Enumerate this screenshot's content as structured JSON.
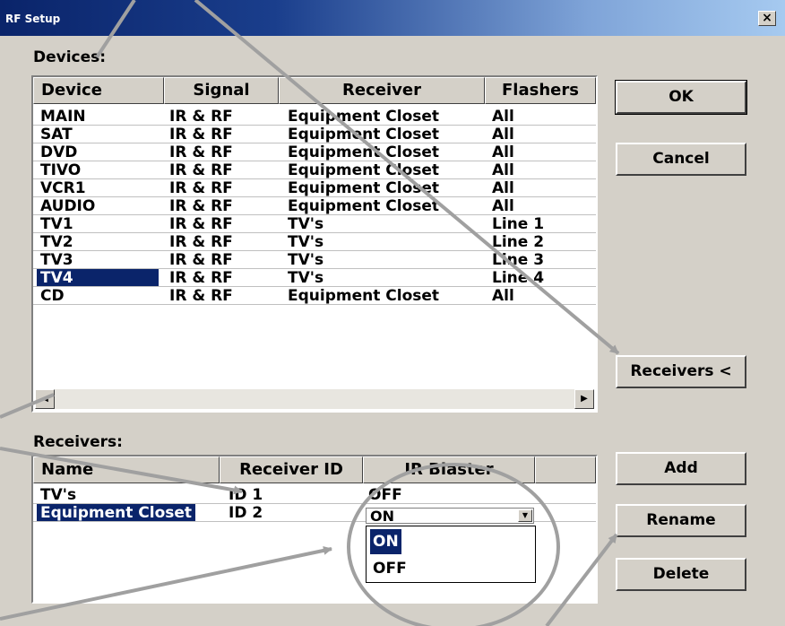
{
  "window": {
    "title": "RF Setup",
    "close_label": "×"
  },
  "devices": {
    "label": "Devices:",
    "headers": [
      "Device",
      "Signal",
      "Receiver",
      "Flashers"
    ],
    "rows": [
      [
        "MAIN",
        "IR & RF",
        "Equipment Closet",
        "All"
      ],
      [
        "SAT",
        "IR & RF",
        "Equipment Closet",
        "All"
      ],
      [
        "DVD",
        "IR & RF",
        "Equipment Closet",
        "All"
      ],
      [
        "TIVO",
        "IR & RF",
        "Equipment Closet",
        "All"
      ],
      [
        "VCR1",
        "IR & RF",
        "Equipment Closet",
        "All"
      ],
      [
        "AUDIO",
        "IR & RF",
        "Equipment Closet",
        "All"
      ],
      [
        "TV1",
        "IR & RF",
        "TV's",
        "Line 1"
      ],
      [
        "TV2",
        "IR & RF",
        "TV's",
        "Line 2"
      ],
      [
        "TV3",
        "IR & RF",
        "TV's",
        "Line 3"
      ],
      [
        "TV4",
        "IR & RF",
        "TV's",
        "Line 4"
      ],
      [
        "CD",
        "IR & RF",
        "Equipment Closet",
        "All"
      ]
    ],
    "selected_row": "TV4",
    "scroll_left": "◀",
    "scroll_right": "▶"
  },
  "receivers": {
    "label": "Receivers:",
    "headers": [
      "Name",
      "Receiver ID",
      "IR Blaster"
    ],
    "rows": [
      [
        "TV's",
        "ID 1",
        "OFF"
      ],
      [
        "Equipment Closet",
        "ID 2",
        "ON"
      ]
    ],
    "selected_row": "Equipment Closet",
    "combo_value": "ON",
    "combo_arrow": "▼",
    "dropdown_options": [
      "ON",
      "OFF"
    ],
    "dropdown_selected": "ON"
  },
  "buttons": {
    "ok": "OK",
    "cancel": "Cancel",
    "receivers_toggle": "Receivers <",
    "add": "Add",
    "rename": "Rename",
    "delete": "Delete"
  },
  "colors": {
    "selection": "#0a246a",
    "dialog_bg": "#d4d0c8",
    "annotation": "#a0a0a0"
  }
}
